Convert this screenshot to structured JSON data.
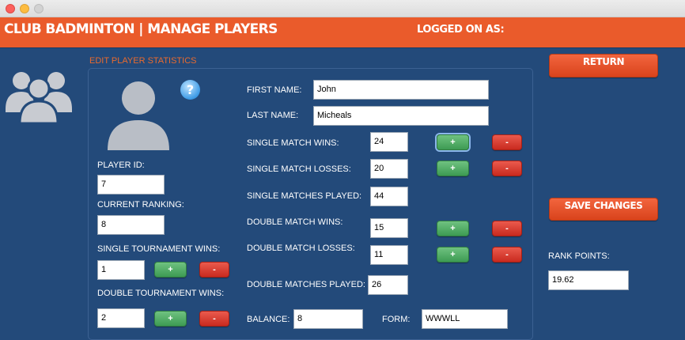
{
  "header": {
    "title": "CLUB BADMINTON | MANAGE PLAYERS",
    "logged_on": "LOGGED ON AS:"
  },
  "section_title": "EDIT PLAYER STATISTICS",
  "icons": {
    "players": "users-icon",
    "avatar": "user-avatar-icon",
    "help": "help-icon"
  },
  "help_glyph": "?",
  "player": {
    "id_label": "PLAYER ID:",
    "id_value": "7",
    "ranking_label": "CURRENT RANKING:",
    "ranking_value": "8",
    "single_tournament_label": "SINGLE TOURNAMENT WINS:",
    "single_tournament_value": "1",
    "double_tournament_label": "DOUBLE TOURNAMENT WINS:",
    "double_tournament_value": "2"
  },
  "form": {
    "first_name_label": "FIRST NAME:",
    "first_name_value": "John",
    "last_name_label": "LAST NAME:",
    "last_name_value": "Micheals",
    "single_wins_label": "SINGLE MATCH WINS:",
    "single_wins_value": "24",
    "single_losses_label": "SINGLE MATCH LOSSES:",
    "single_losses_value": "20",
    "single_played_label": "SINGLE MATCHES PLAYED:",
    "single_played_value": "44",
    "double_wins_label": "DOUBLE MATCH WINS:",
    "double_wins_value": "15",
    "double_losses_label": "DOUBLE MATCH LOSSES:",
    "double_losses_value": "11",
    "double_played_label": "DOUBLE MATCHES PLAYED:",
    "double_played_value": "26",
    "balance_label": "BALANCE:",
    "balance_value": "8",
    "form_label": "FORM:",
    "form_value": "WWWLL"
  },
  "buttons": {
    "plus": "+",
    "minus": "-",
    "return": "RETURN",
    "save": "SAVE CHANGES"
  },
  "rank": {
    "label": "RANK POINTS:",
    "value": "19.62"
  },
  "colors": {
    "header": "#ea5b2b",
    "background": "#234a7a",
    "accent_text": "#e96a2e",
    "plus_button": "#4caf63",
    "minus_button": "#d9362a"
  }
}
